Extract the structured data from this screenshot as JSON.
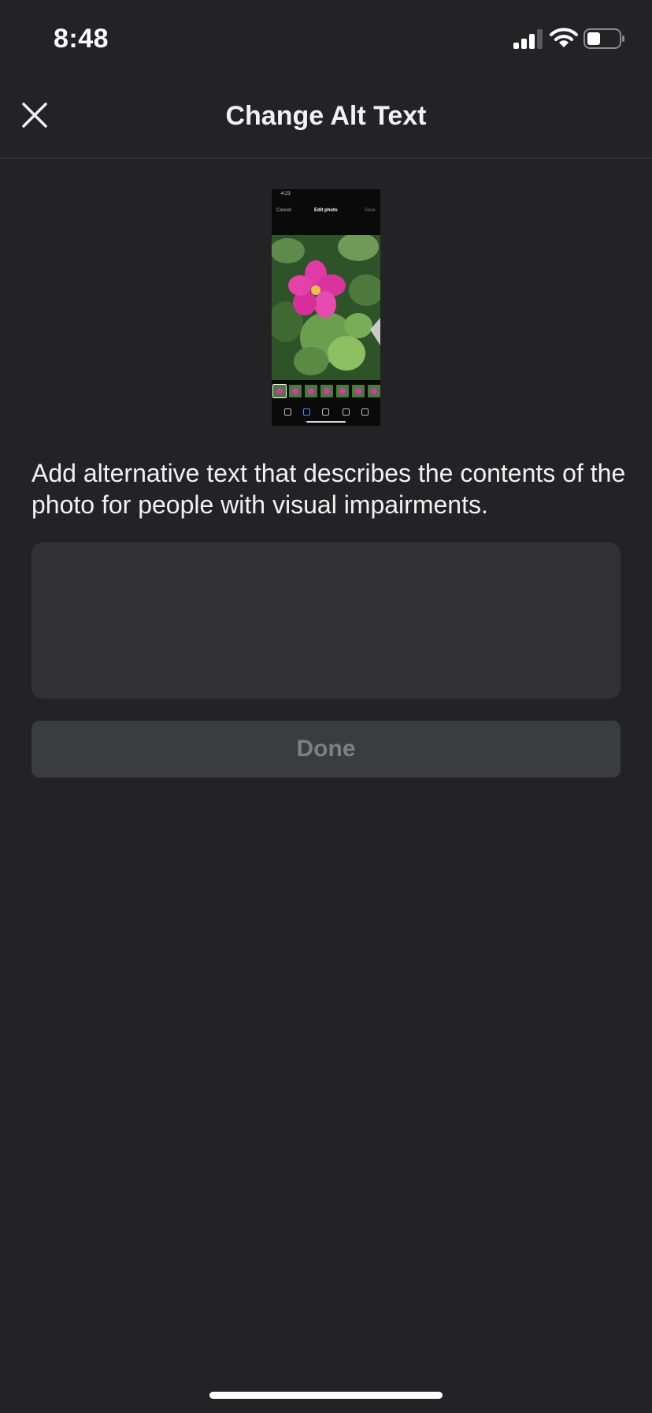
{
  "status_bar": {
    "time": "8:48",
    "icons": [
      "signal-icon",
      "wifi-icon",
      "battery-icon"
    ]
  },
  "nav": {
    "title": "Change Alt Text",
    "close_icon": "close-icon"
  },
  "thumbnail": {
    "status_time": "4:23",
    "cancel_label": "Cancel",
    "title": "Edit photo",
    "save_label": "Save",
    "accent": "#d43aa3"
  },
  "main": {
    "description": "Add alternative text that describes the contents of the photo for people with visual impairments.",
    "alt_text_value": "",
    "alt_text_placeholder": "",
    "done_label": "Done"
  },
  "colors": {
    "background": "#232325",
    "input_background": "#323235",
    "button_disabled_background": "#3b3c3e",
    "button_disabled_text": "#7e7f82"
  }
}
